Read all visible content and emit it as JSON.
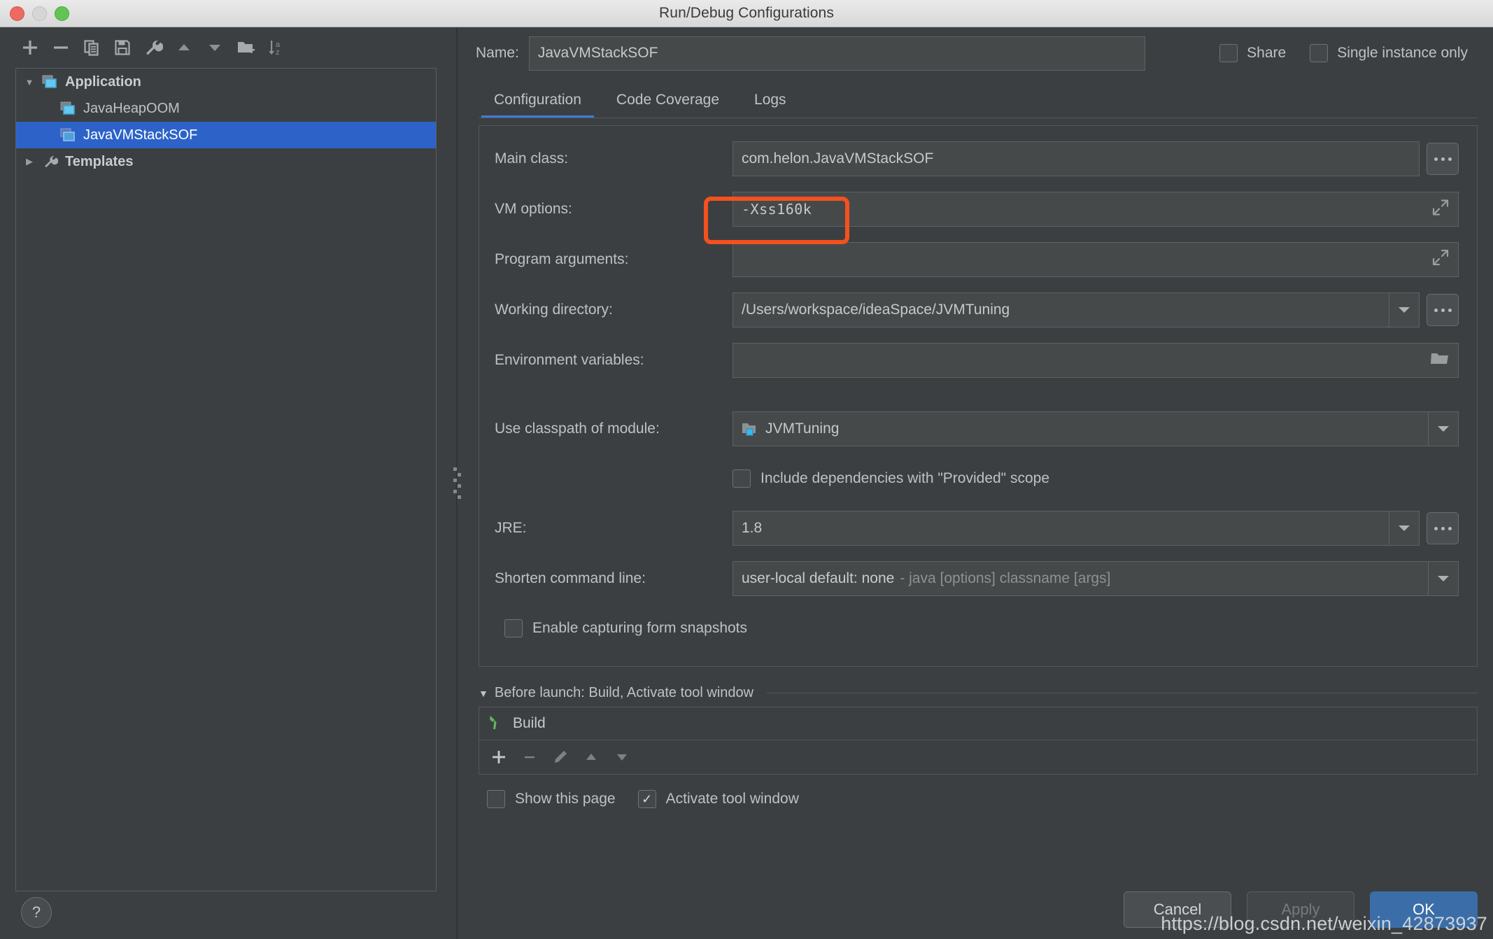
{
  "window": {
    "title": "Run/Debug Configurations",
    "traffic_lights": [
      "close-red",
      "minimize-yellow",
      "maximize-green"
    ]
  },
  "left_panel": {
    "toolbar": [
      {
        "name": "add",
        "icon": "plus-icon"
      },
      {
        "name": "remove",
        "icon": "minus-icon"
      },
      {
        "name": "copy",
        "icon": "copy-icon"
      },
      {
        "name": "save",
        "icon": "save-icon"
      },
      {
        "name": "edit-templates",
        "icon": "wrench-icon"
      },
      {
        "name": "move-up",
        "icon": "triangle-up-icon"
      },
      {
        "name": "move-down",
        "icon": "triangle-down-icon"
      },
      {
        "name": "new-folder",
        "icon": "folder-plus-icon"
      },
      {
        "name": "sort-alphabetically",
        "icon": "sort-az-icon"
      }
    ],
    "tree": [
      {
        "label": "Application",
        "level": 1,
        "expander": "down",
        "icon": "application-icon",
        "bold": true,
        "selected": false
      },
      {
        "label": "JavaHeapOOM",
        "level": 2,
        "expander": "none",
        "icon": "application-icon",
        "bold": false,
        "selected": false
      },
      {
        "label": "JavaVMStackSOF",
        "level": 2,
        "expander": "none",
        "icon": "application-icon",
        "bold": false,
        "selected": true
      },
      {
        "label": "Templates",
        "level": 1,
        "expander": "right",
        "icon": "wrench-icon",
        "bold": true,
        "selected": false
      }
    ],
    "help_button": "?"
  },
  "header": {
    "name_label": "Name:",
    "name_value": "JavaVMStackSOF",
    "share": {
      "label": "Share",
      "checked": false
    },
    "single_instance": {
      "label": "Single instance only",
      "checked": false
    }
  },
  "tabs": [
    {
      "label": "Configuration",
      "active": true
    },
    {
      "label": "Code Coverage",
      "active": false
    },
    {
      "label": "Logs",
      "active": false
    }
  ],
  "form": {
    "main_class": {
      "label": "Main class:",
      "value": "com.helon.JavaVMStackSOF",
      "browse": "..."
    },
    "vm_options": {
      "label": "VM options:",
      "value": "-Xss160k",
      "expand_icon": "expand-arrows-icon"
    },
    "program_arguments": {
      "label": "Program arguments:",
      "value": "",
      "expand_icon": "expand-arrows-icon"
    },
    "working_directory": {
      "label": "Working directory:",
      "value": "/Users/workspace/ideaSpace/JVMTuning",
      "dropdown": "chevron-down-icon",
      "browse": "..."
    },
    "environment_variables": {
      "label": "Environment variables:",
      "value": "",
      "folder_icon": "folder-icon"
    },
    "use_classpath_of_module": {
      "label": "Use classpath of module:",
      "value": "JVMTuning",
      "icon": "module-icon",
      "dropdown": "chevron-down-icon"
    },
    "include_provided": {
      "label": "Include dependencies with \"Provided\" scope",
      "checked": false
    },
    "jre": {
      "label": "JRE:",
      "value": "1.8",
      "dropdown": "chevron-down-icon",
      "browse": "..."
    },
    "shorten_command_line": {
      "label": "Shorten command line:",
      "value_strong": "user-local default: none",
      "value_dim": "- java [options] classname [args]",
      "dropdown": "chevron-down-icon"
    },
    "enable_form_snapshots": {
      "label": "Enable capturing form snapshots",
      "checked": false
    }
  },
  "before_launch": {
    "header": "Before launch: Build, Activate tool window",
    "expander": "down",
    "items": [
      {
        "label": "Build",
        "icon": "hammer-icon"
      }
    ],
    "tools": [
      {
        "name": "add-task",
        "icon": "plus-icon",
        "enabled": true
      },
      {
        "name": "remove-task",
        "icon": "minus-icon",
        "enabled": false
      },
      {
        "name": "edit-task",
        "icon": "pencil-icon",
        "enabled": false
      },
      {
        "name": "move-task-up",
        "icon": "triangle-up-icon",
        "enabled": false
      },
      {
        "name": "move-task-down",
        "icon": "triangle-down-icon",
        "enabled": false
      }
    ],
    "show_this_page": {
      "label": "Show this page",
      "checked": false
    },
    "activate_tool_window": {
      "label": "Activate tool window",
      "checked": true
    }
  },
  "footer": {
    "cancel": "Cancel",
    "apply": "Apply",
    "ok": "OK"
  },
  "watermark": "https://blog.csdn.net/weixin_42873937",
  "colors": {
    "background": "#3c3f41",
    "selection_blue": "#2d63c8",
    "tab_accent": "#3d7dd8",
    "annotation_orange": "#f4511e",
    "ok_button_blue": "#3b6ea8",
    "hammer_green": "#5fb65f"
  },
  "annotation": {
    "target": "vm_options_field",
    "shape": "rectangle",
    "color": "#f4511e"
  }
}
